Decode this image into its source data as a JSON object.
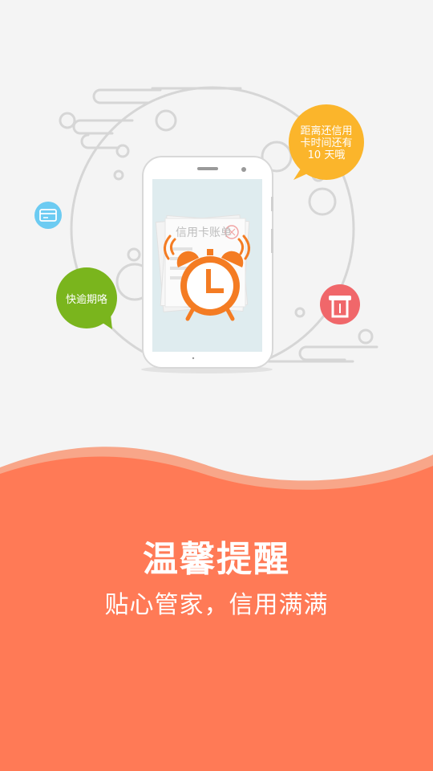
{
  "illustration": {
    "bill_label": "信用卡账单",
    "reminder_bubble": {
      "line1": "距离还信用",
      "line2": "卡时间还有",
      "line3": "10 天哦"
    },
    "overdue_bubble": "快逾期咯"
  },
  "banner": {
    "title": "温馨提醒",
    "subtitle": "贴心管家，信用满满"
  },
  "colors": {
    "accent": "#ff7a56",
    "wave_light": "#f8a689",
    "orange_bubble": "#fbb52b",
    "green_bubble": "#7ab51d",
    "red_icon": "#f0676a",
    "blue_icon": "#6ccbf2",
    "alarm": "#f47c23"
  },
  "icons": [
    "card-icon",
    "atm-icon",
    "alarm-clock-icon"
  ]
}
